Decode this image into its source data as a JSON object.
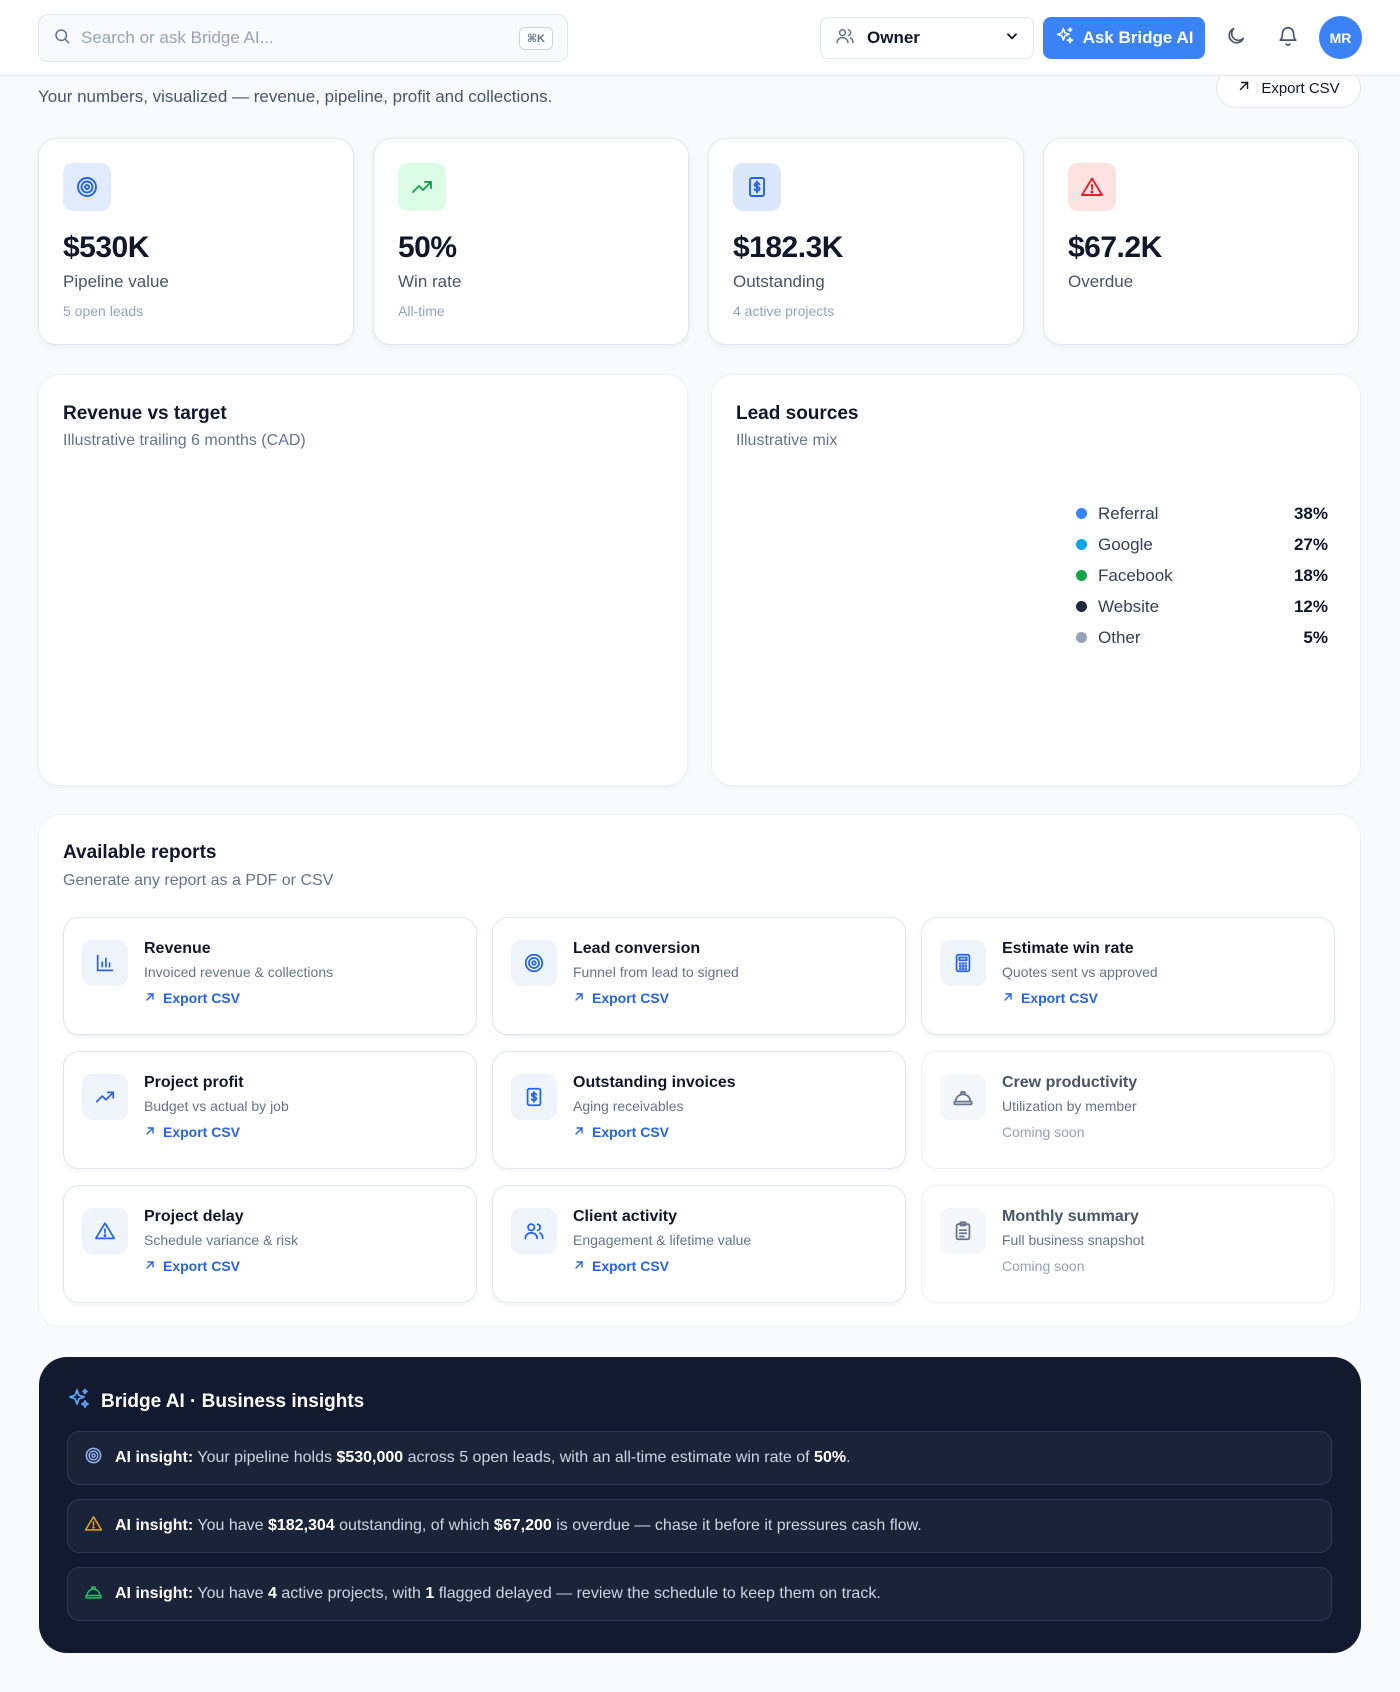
{
  "topbar": {
    "search_placeholder": "Search or ask Bridge AI...",
    "search_shortcut": "⌘K",
    "role_label": "Owner",
    "ask_label": "Ask Bridge AI",
    "avatar_initials": "MR"
  },
  "header": {
    "subtitle": "Your numbers, visualized — revenue, pipeline, profit and collections.",
    "export_label": "Export CSV"
  },
  "kpis": [
    {
      "value": "$530K",
      "label": "Pipeline value",
      "note": "5 open leads",
      "icon": "target-icon",
      "color": "#2563eb",
      "bg": "#e0ebfd"
    },
    {
      "value": "50%",
      "label": "Win rate",
      "note": "All-time",
      "icon": "trend-up-icon",
      "color": "#16a34a",
      "bg": "#dcfce7"
    },
    {
      "value": "$182.3K",
      "label": "Outstanding",
      "note": "4 active projects",
      "icon": "invoice-icon",
      "color": "#2563eb",
      "bg": "#dbe7fb"
    },
    {
      "value": "$67.2K",
      "label": "Overdue",
      "note": "",
      "icon": "warning-icon",
      "color": "#dc2626",
      "bg": "#fde2e2"
    }
  ],
  "revenue_panel": {
    "title": "Revenue vs target",
    "subtitle": "Illustrative trailing 6 months (CAD)"
  },
  "leads_panel": {
    "title": "Lead sources",
    "subtitle": "Illustrative mix",
    "items": [
      {
        "name": "Referral",
        "pct": "38%",
        "color": "#3b82f6"
      },
      {
        "name": "Google",
        "pct": "27%",
        "color": "#0ea5e9"
      },
      {
        "name": "Facebook",
        "pct": "18%",
        "color": "#16a34a"
      },
      {
        "name": "Website",
        "pct": "12%",
        "color": "#1e293b"
      },
      {
        "name": "Other",
        "pct": "5%",
        "color": "#94a3b8"
      }
    ]
  },
  "reports": {
    "title": "Available reports",
    "subtitle": "Generate any report as a PDF or CSV",
    "items": [
      {
        "name": "Revenue",
        "desc": "Invoiced revenue & collections",
        "action": "Export CSV",
        "icon": "bar-chart-icon"
      },
      {
        "name": "Lead conversion",
        "desc": "Funnel from lead to signed",
        "action": "Export CSV",
        "icon": "target-icon"
      },
      {
        "name": "Estimate win rate",
        "desc": "Quotes sent vs approved",
        "action": "Export CSV",
        "icon": "calculator-icon"
      },
      {
        "name": "Project profit",
        "desc": "Budget vs actual by job",
        "action": "Export CSV",
        "icon": "trend-up-icon"
      },
      {
        "name": "Outstanding invoices",
        "desc": "Aging receivables",
        "action": "Export CSV",
        "icon": "invoice-icon"
      },
      {
        "name": "Crew productivity",
        "desc": "Utilization by member",
        "action": "Coming soon",
        "icon": "hard-hat-icon"
      },
      {
        "name": "Project delay",
        "desc": "Schedule variance & risk",
        "action": "Export CSV",
        "icon": "warning-icon"
      },
      {
        "name": "Client activity",
        "desc": "Engagement & lifetime value",
        "action": "Export CSV",
        "icon": "users-icon"
      },
      {
        "name": "Monthly summary",
        "desc": "Full business snapshot",
        "action": "Coming soon",
        "icon": "clipboard-icon"
      }
    ]
  },
  "ai": {
    "title": "Bridge AI · Business insights",
    "insights": [
      {
        "icon": "target-icon",
        "color": "#93b4f5",
        "prefix": "AI insight:",
        "parts": [
          {
            "t": "Your pipeline holds ",
            "b": false
          },
          {
            "t": "$530,000",
            "b": true
          },
          {
            "t": " across 5 open leads, with an all-time estimate win rate of ",
            "b": false
          },
          {
            "t": "50%",
            "b": true
          },
          {
            "t": ".",
            "b": false
          }
        ]
      },
      {
        "icon": "warning-icon",
        "color": "#f59e0b",
        "prefix": "AI insight:",
        "parts": [
          {
            "t": "You have ",
            "b": false
          },
          {
            "t": "$182,304",
            "b": true
          },
          {
            "t": " outstanding, of which ",
            "b": false
          },
          {
            "t": "$67,200",
            "b": true
          },
          {
            "t": " is overdue — chase it before it pressures cash flow.",
            "b": false
          }
        ]
      },
      {
        "icon": "hard-hat-icon",
        "color": "#22c55e",
        "prefix": "AI insight:",
        "parts": [
          {
            "t": "You have ",
            "b": false
          },
          {
            "t": "4",
            "b": true
          },
          {
            "t": " active projects, with ",
            "b": false
          },
          {
            "t": "1",
            "b": true
          },
          {
            "t": " flagged delayed — review the schedule to keep them on track.",
            "b": false
          }
        ]
      }
    ]
  }
}
